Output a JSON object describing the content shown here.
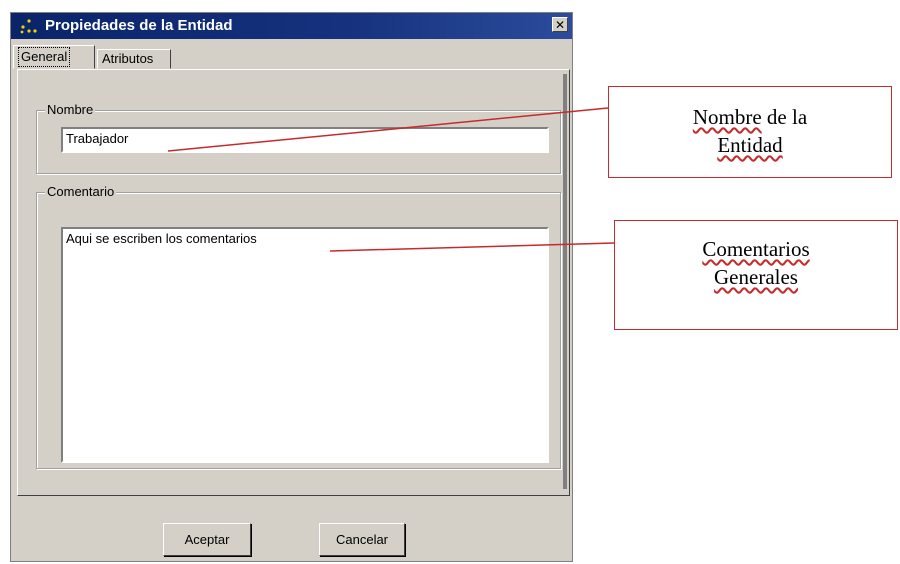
{
  "window": {
    "title": "Propiedades de la Entidad",
    "close_label": "✕"
  },
  "tabs": [
    {
      "label": "General",
      "selected": true
    },
    {
      "label": "Atributos",
      "selected": false
    }
  ],
  "nombre": {
    "legend": "Nombre",
    "value": "Trabajador"
  },
  "comentario": {
    "legend": "Comentario",
    "value": "Aqui se escriben los comentarios"
  },
  "buttons": {
    "accept_label": "Aceptar",
    "cancel_label": "Cancelar"
  },
  "callouts": {
    "nombre_line1_a": "Nombre",
    "nombre_line1_b": " de la",
    "nombre_line2": "Entidad",
    "comentarios_line1": "Comentarios",
    "comentarios_line2": "Generales"
  },
  "colors": {
    "titlebar": "#0a246a",
    "callout_border": "#c62b2b",
    "dialog_face": "#d4d0c8"
  }
}
